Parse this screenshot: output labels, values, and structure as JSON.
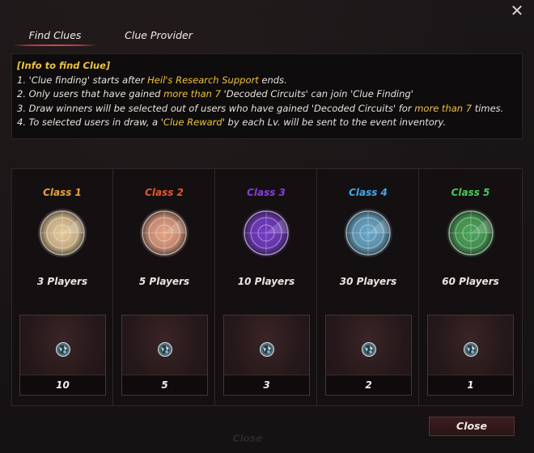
{
  "window": {
    "close_icon": "close-icon"
  },
  "tabs": [
    {
      "label": "Find Clues",
      "active": true
    },
    {
      "label": "Clue Provider",
      "active": false
    }
  ],
  "info": {
    "header": "[Info to find Clue]",
    "line1_a": "1. 'Clue finding' starts after ",
    "line1_hl": "Heil's Research Support",
    "line1_b": " ends.",
    "line2_a": "2. Only users that have gained ",
    "line2_hl": "more than 7",
    "line2_b": " 'Decoded Circuits' can join 'Clue Finding'",
    "line3_a": "3. Draw winners will be selected out of users who have gained 'Decoded Circuits' for ",
    "line3_hl": "more than 7",
    "line3_b": " times.",
    "line4_a": "4. To selected users in draw, a '",
    "line4_hl": "Clue Reward",
    "line4_b": "' by each Lv. will be sent to the event inventory."
  },
  "classes": [
    {
      "name": "Class 1",
      "color": "#e8a23a",
      "radar_color": "#f0d2a0",
      "players": "3 Players",
      "amount": "10"
    },
    {
      "name": "Class 2",
      "color": "#e4582e",
      "radar_color": "#f0a98a",
      "players": "5 Players",
      "amount": "5"
    },
    {
      "name": "Class 3",
      "color": "#8a3be0",
      "radar_color": "#7a3fd0",
      "players": "10 Players",
      "amount": "3"
    },
    {
      "name": "Class 4",
      "color": "#46a8e6",
      "radar_color": "#6fb0d2",
      "players": "30 Players",
      "amount": "2"
    },
    {
      "name": "Class 5",
      "color": "#49c95a",
      "radar_color": "#4fae5e",
      "players": "60 Players",
      "amount": "1"
    }
  ],
  "buttons": {
    "close_label": "Close",
    "ghost_close_label": "Close"
  }
}
